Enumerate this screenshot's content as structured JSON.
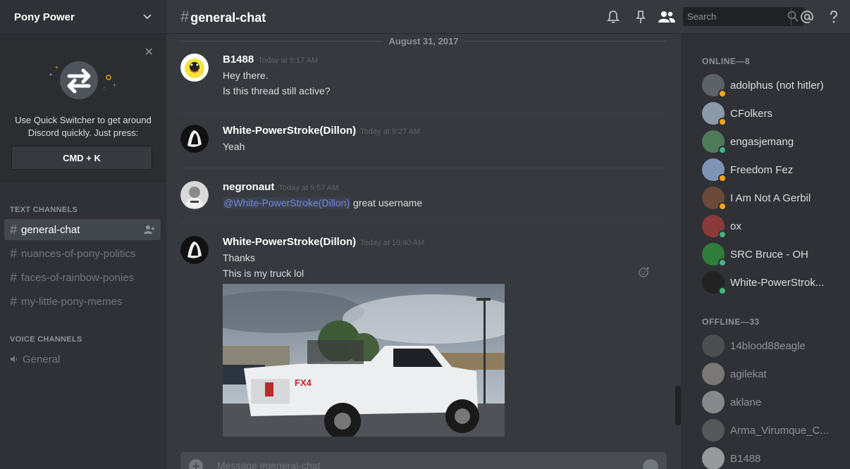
{
  "server": {
    "name": "Pony Power"
  },
  "quick_switcher": {
    "text": "Use Quick Switcher to get around Discord quickly. Just press:",
    "shortcut": "CMD + K"
  },
  "text_channels": {
    "heading": "TEXT CHANNELS",
    "items": [
      {
        "label": "general-chat",
        "active": true
      },
      {
        "label": "nuances-of-pony-politics"
      },
      {
        "label": "faces-of-rainbow-ponies"
      },
      {
        "label": "my-little-pony-memes"
      }
    ]
  },
  "voice_channels": {
    "heading": "VOICE CHANNELS",
    "items": [
      {
        "label": "General"
      }
    ]
  },
  "header": {
    "channel": "general-chat",
    "hash": "#",
    "search_placeholder": "Search"
  },
  "messages": {
    "date": "August 31, 2017",
    "items": [
      {
        "author": "B1488",
        "time": "Today at 9:17 AM",
        "lines": [
          "Hey there.",
          "Is this thread still active?"
        ]
      },
      {
        "author": "White-PowerStroke(Dillon)",
        "time": "Today at 9:27 AM",
        "lines": [
          "Yeah"
        ]
      },
      {
        "author": "negronaut",
        "time": "Today at 9:57 AM",
        "mention": "@White-PowerStroke(Dillon)",
        "text": " great username"
      },
      {
        "author": "White-PowerStroke(Dillon)",
        "time": "Today at 10:40 AM",
        "lines": [
          "Thanks",
          "This is my truck lol"
        ]
      }
    ]
  },
  "composer": {
    "placeholder": "Message #general-chat"
  },
  "members": {
    "online_heading": "ONLINE—8",
    "offline_heading": "OFFLINE—33",
    "online": [
      {
        "name": "adolphus (not hitler)",
        "status": "idle"
      },
      {
        "name": "CFolkers",
        "status": "idle"
      },
      {
        "name": "engasjemang",
        "status": "online"
      },
      {
        "name": "Freedom Fez",
        "status": "idle"
      },
      {
        "name": "I Am Not A Gerbil",
        "status": "idle"
      },
      {
        "name": "ox",
        "status": "online"
      },
      {
        "name": "SRC Bruce - OH",
        "status": "online"
      },
      {
        "name": "White-PowerStrok...",
        "status": "online"
      }
    ],
    "offline": [
      {
        "name": "14blood88eagle"
      },
      {
        "name": "agilekat"
      },
      {
        "name": "aklane"
      },
      {
        "name": "Arma_Virumque_C..."
      },
      {
        "name": "B1488"
      }
    ]
  },
  "colors": {
    "idle": "#faa61a",
    "online": "#43b581",
    "accent": "#7289da"
  }
}
